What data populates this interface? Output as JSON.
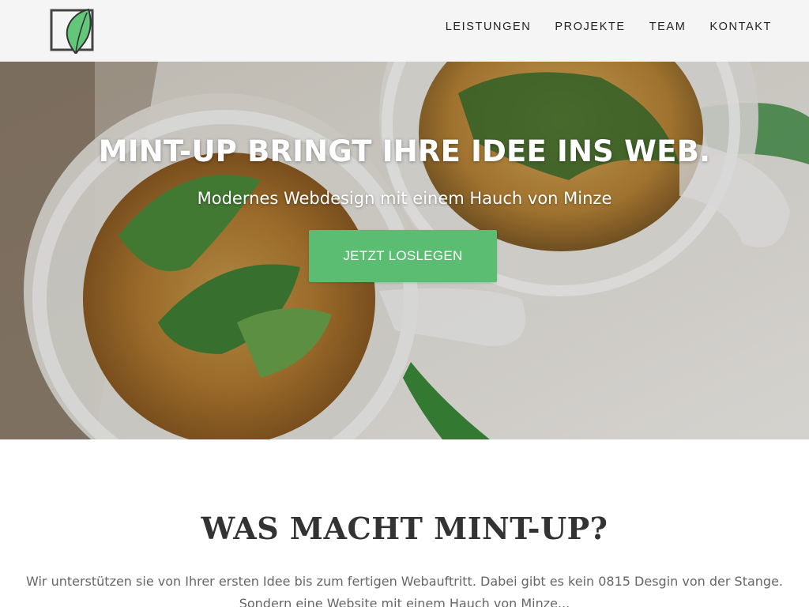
{
  "header": {
    "logo": "leaf-logo-icon",
    "nav": [
      "LEISTUNGEN",
      "PROJEKTE",
      "TEAM",
      "KONTAKT"
    ]
  },
  "hero": {
    "title": "MINT-UP BRINGT IHRE IDEE INS WEB.",
    "subtitle": "Modernes Webdesign mit einem Hauch von Minze",
    "cta_label": "JETZT LOSLEGEN",
    "image": "tea-glasses-with-mint-photo"
  },
  "section": {
    "title": "WAS MACHT MINT-UP?",
    "text_line1": "Wir unterstützen sie von Ihrer ersten Idee bis zum fertigen Webauftritt. Dabei gibt es kein 0815 Desgin von der Stange.",
    "text_line2": "Sondern eine Website mit einem Hauch von Minze..."
  },
  "colors": {
    "accent": "#5bbd72",
    "header_bg": "#f5f5f5",
    "text": "#333333"
  }
}
